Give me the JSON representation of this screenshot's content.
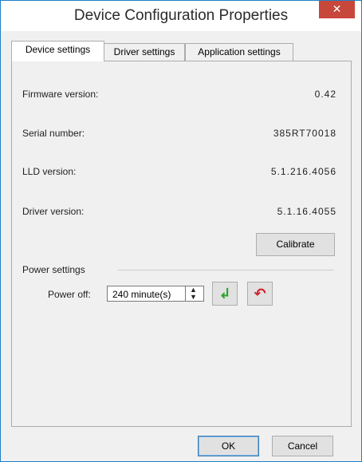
{
  "window": {
    "title": "Device Configuration Properties",
    "close_glyph": "✕",
    "close_icon": "close-icon"
  },
  "tabs": [
    {
      "label": "Device settings",
      "active": true
    },
    {
      "label": "Driver settings",
      "active": false
    },
    {
      "label": "Application settings",
      "active": false
    }
  ],
  "info": [
    {
      "label": "Firmware version:",
      "value": "0.42"
    },
    {
      "label": "Serial number:",
      "value": "385RT70018"
    },
    {
      "label": "LLD version:",
      "value": "5.1.216.4056"
    },
    {
      "label": "Driver version:",
      "value": "5.1.16.4055"
    }
  ],
  "calibrate_label": "Calibrate",
  "power": {
    "group_label": "Power settings",
    "power_off_label": "Power off:",
    "power_off_value": "240 minute(s)",
    "spin_up": "▲",
    "spin_down": "▼",
    "apply_icon": "enter-arrow-icon",
    "apply_glyph": "↲",
    "revert_icon": "undo-icon",
    "revert_glyph": "↶",
    "apply_color": "#2aa52a",
    "revert_color": "#d0212b"
  },
  "footer": {
    "ok_label": "OK",
    "cancel_label": "Cancel"
  }
}
